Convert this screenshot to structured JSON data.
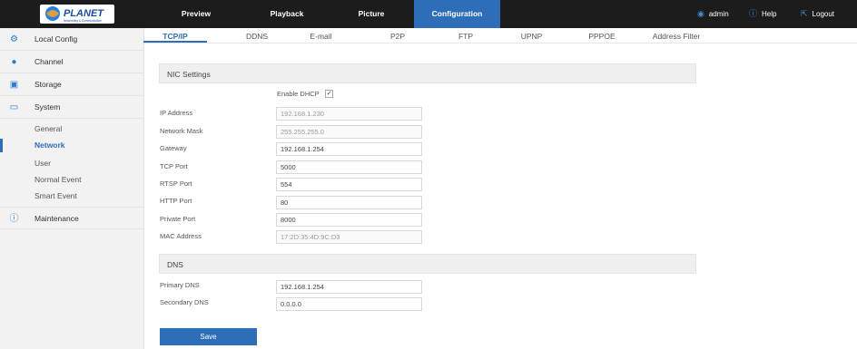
{
  "app": {
    "logo_text": "PLANET",
    "logo_tagline": "Networking & Communication"
  },
  "topnav": {
    "tabs": [
      {
        "label": "Preview"
      },
      {
        "label": "Playback"
      },
      {
        "label": "Picture"
      },
      {
        "label": "Configuration",
        "active": true
      }
    ],
    "user": "admin",
    "help": "Help",
    "logout": "Logout"
  },
  "sidebar": {
    "items": [
      {
        "label": "Local Config",
        "icon": "gear-icon"
      },
      {
        "label": "Channel",
        "icon": "channel-icon"
      },
      {
        "label": "Storage",
        "icon": "storage-icon"
      },
      {
        "label": "System",
        "icon": "monitor-icon"
      }
    ],
    "system_subitems": [
      {
        "label": "General"
      },
      {
        "label": "Network",
        "active": true
      },
      {
        "label": "User"
      },
      {
        "label": "Normal Event"
      },
      {
        "label": "Smart Event"
      }
    ],
    "maintenance": {
      "label": "Maintenance",
      "icon": "info-icon"
    }
  },
  "subtabs": [
    {
      "label": "TCP/IP",
      "active": true
    },
    {
      "label": "DDNS"
    },
    {
      "label": "E-mail"
    },
    {
      "label": "P2P"
    },
    {
      "label": "FTP"
    },
    {
      "label": "UPNP"
    },
    {
      "label": "PPPOE"
    },
    {
      "label": "Address Filter"
    }
  ],
  "nic": {
    "heading": "NIC Settings",
    "dhcp_label": "Enable DHCP",
    "dhcp_checked": true,
    "fields": [
      {
        "label": "IP Address",
        "value": "192.168.1.230",
        "readonly": true
      },
      {
        "label": "Network Mask",
        "value": "255.255.255.0",
        "readonly": true
      },
      {
        "label": "Gateway",
        "value": "192.168.1.254",
        "readonly": false
      },
      {
        "label": "TCP Port",
        "value": "5000",
        "readonly": false
      },
      {
        "label": "RTSP Port",
        "value": "554",
        "readonly": false
      },
      {
        "label": "HTTP Port",
        "value": "80",
        "readonly": false
      },
      {
        "label": "Private Port",
        "value": "8000",
        "readonly": false
      },
      {
        "label": "MAC Address",
        "value": "17:2D:35:4D:9C:D3",
        "readonly": true
      }
    ]
  },
  "dns": {
    "heading": "DNS",
    "fields": [
      {
        "label": "Primary DNS",
        "value": "192.168.1.254"
      },
      {
        "label": "Secondary DNS",
        "value": "0.0.0.0"
      }
    ]
  },
  "actions": {
    "save_label": "Save"
  },
  "colors": {
    "accent": "#2e6eb8",
    "topbar": "#1c1c1c",
    "sidebar": "#f2f2f2"
  }
}
